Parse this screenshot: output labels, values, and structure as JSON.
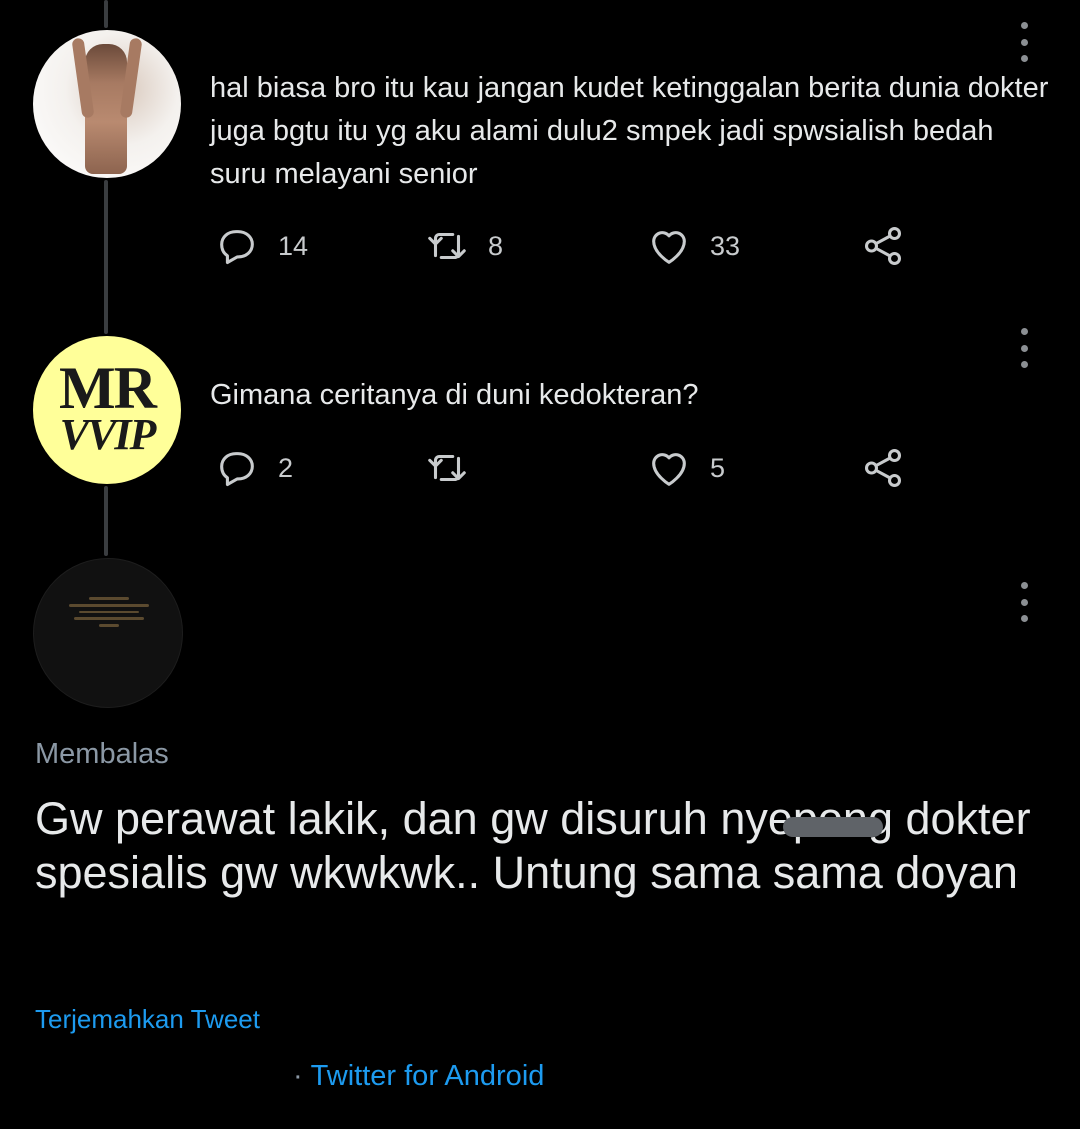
{
  "thread": {
    "tweets": [
      {
        "avatar_icon": "profile-photo-icon",
        "text": "hal biasa bro itu kau jangan kudet ketinggalan berita dunia dokter juga bgtu itu yg aku alami dulu2 smpek jadi spwsialish bedah suru melayani senior",
        "replies": "14",
        "retweets": "8",
        "likes": "33"
      },
      {
        "avatar_icon": "mr-vvip-logo-icon",
        "avatar_logo_top": "MR",
        "avatar_logo_bottom": "VVIP",
        "text": "Gimana ceritanya di duni kedokteran?",
        "replies": "2",
        "retweets": "",
        "likes": "5"
      }
    ]
  },
  "main_tweet": {
    "avatar_icon": "dark-profile-photo-icon",
    "replying_label": "Membalas",
    "text": "Gw perawat lakik, dan gw disuruh nyepong dokter spesialis gw wkwkwk.. Untung sama sama doyan",
    "translate_label": "Terjemahkan Tweet",
    "source_separator": "·",
    "source_label": "Twitter for Android"
  },
  "icons": {
    "reply": "reply-icon",
    "retweet": "retweet-icon",
    "like": "heart-icon",
    "share": "share-icon",
    "more": "more-vertical-icon"
  },
  "colors": {
    "background": "#000000",
    "text": "#e7e9ea",
    "muted": "#8b98a5",
    "link": "#1d9bf0",
    "thread_line": "#3a3d40",
    "avatar_logo_bg": "#ffff99"
  }
}
